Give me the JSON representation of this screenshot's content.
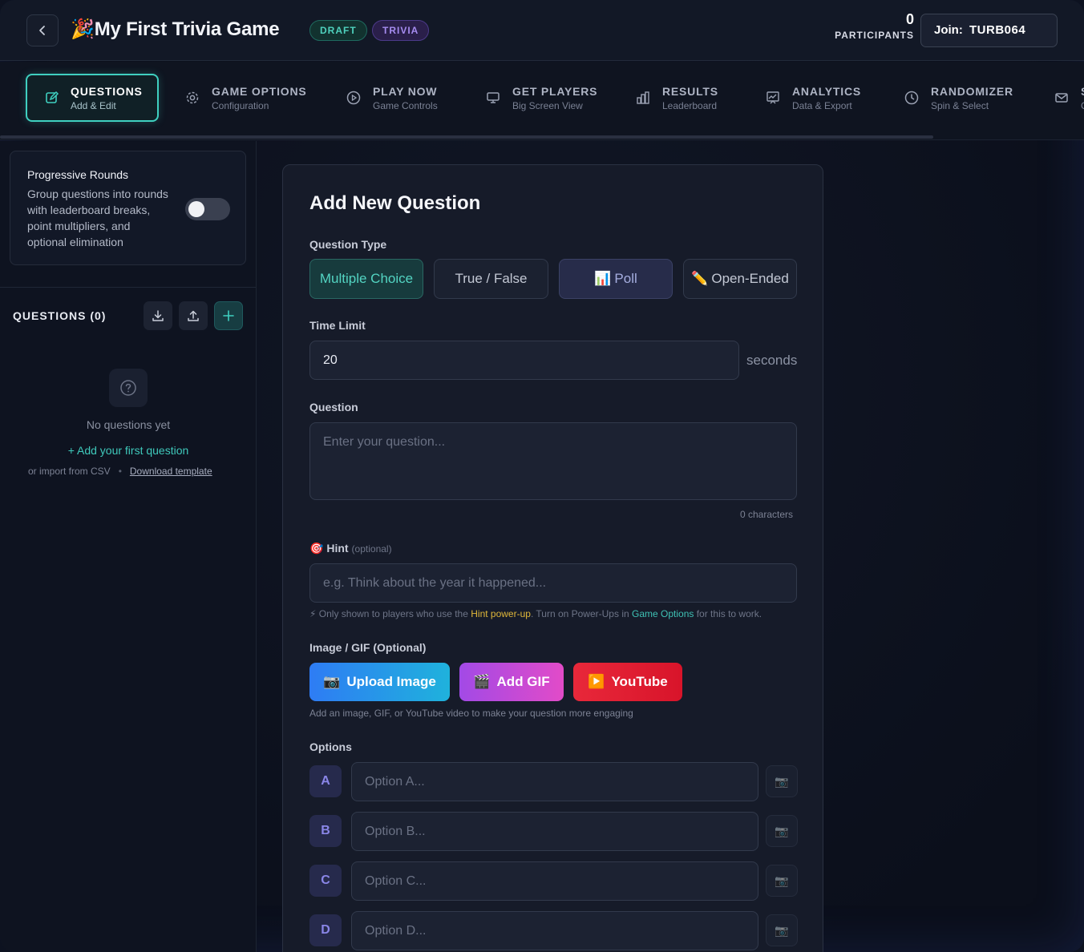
{
  "header": {
    "title_emoji": "🎉",
    "title": "My First Trivia Game",
    "badges": [
      "DRAFT",
      "TRIVIA"
    ],
    "participants_count": "0",
    "participants_label": "PARTICIPANTS",
    "join_label": "Join:",
    "join_code": "TURB064"
  },
  "tabs": [
    {
      "label": "QUESTIONS",
      "sub": "Add & Edit",
      "icon": "edit-icon",
      "active": true
    },
    {
      "label": "GAME OPTIONS",
      "sub": "Configuration",
      "icon": "gear-icon"
    },
    {
      "label": "PLAY NOW",
      "sub": "Game Controls",
      "icon": "play-icon"
    },
    {
      "label": "GET PLAYERS",
      "sub": "Big Screen View",
      "icon": "monitor-icon"
    },
    {
      "label": "RESULTS",
      "sub": "Leaderboard",
      "icon": "bar-chart-icon"
    },
    {
      "label": "ANALYTICS",
      "sub": "Data & Export",
      "icon": "analytics-icon"
    },
    {
      "label": "RANDOMIZER",
      "sub": "Spin & Select",
      "icon": "clock-icon"
    },
    {
      "label": "S",
      "sub": "C",
      "icon": "mail-icon"
    }
  ],
  "sidebar": {
    "rounds_title": "Progressive Rounds",
    "rounds_desc": "Group questions into rounds with leaderboard breaks, point multipliers, and optional elimination",
    "rounds_enabled": false,
    "questions_heading": "QUESTIONS (0)",
    "empty_text": "No questions yet",
    "add_first": "+ Add your first question",
    "import_text": "or import from CSV",
    "import_dot": "•",
    "download_template": "Download template"
  },
  "form": {
    "title": "Add New Question",
    "question_type_label": "Question Type",
    "types": [
      {
        "label": "Multiple Choice",
        "emoji": ""
      },
      {
        "label": "True / False",
        "emoji": ""
      },
      {
        "label": "Poll",
        "emoji": "📊"
      },
      {
        "label": "Open-Ended",
        "emoji": "✏️"
      }
    ],
    "selected_type": "Multiple Choice",
    "time_limit_label": "Time Limit",
    "time_limit_value": "20",
    "time_limit_unit": "seconds",
    "question_label": "Question",
    "question_placeholder": "Enter your question...",
    "char_count": "0 characters",
    "hint_emoji": "🎯",
    "hint_label": "Hint",
    "hint_optional": "(optional)",
    "hint_placeholder": "e.g. Think about the year it happened...",
    "hint_note_icon": "⚡",
    "hint_note_1": "Only shown to players who use the",
    "hint_note_link1": "Hint power-up",
    "hint_note_2": ". Turn on Power-Ups in",
    "hint_note_link2": "Game Options",
    "hint_note_3": "for this to work.",
    "media_label": "Image / GIF (Optional)",
    "media_buttons": [
      {
        "emoji": "📷",
        "label": "Upload Image"
      },
      {
        "emoji": "🎬",
        "label": "Add GIF"
      },
      {
        "emoji": "▶️",
        "label": "YouTube"
      }
    ],
    "media_note": "Add an image, GIF, or YouTube video to make your question more engaging",
    "options_label": "Options",
    "options": [
      {
        "letter": "A",
        "placeholder": "Option A..."
      },
      {
        "letter": "B",
        "placeholder": "Option B..."
      },
      {
        "letter": "C",
        "placeholder": "Option C..."
      },
      {
        "letter": "D",
        "placeholder": "Option D..."
      }
    ],
    "option_image_emoji": "📷"
  },
  "colors": {
    "accent": "#3fd0c0",
    "background": "#0d1220",
    "card": "#161b29"
  }
}
